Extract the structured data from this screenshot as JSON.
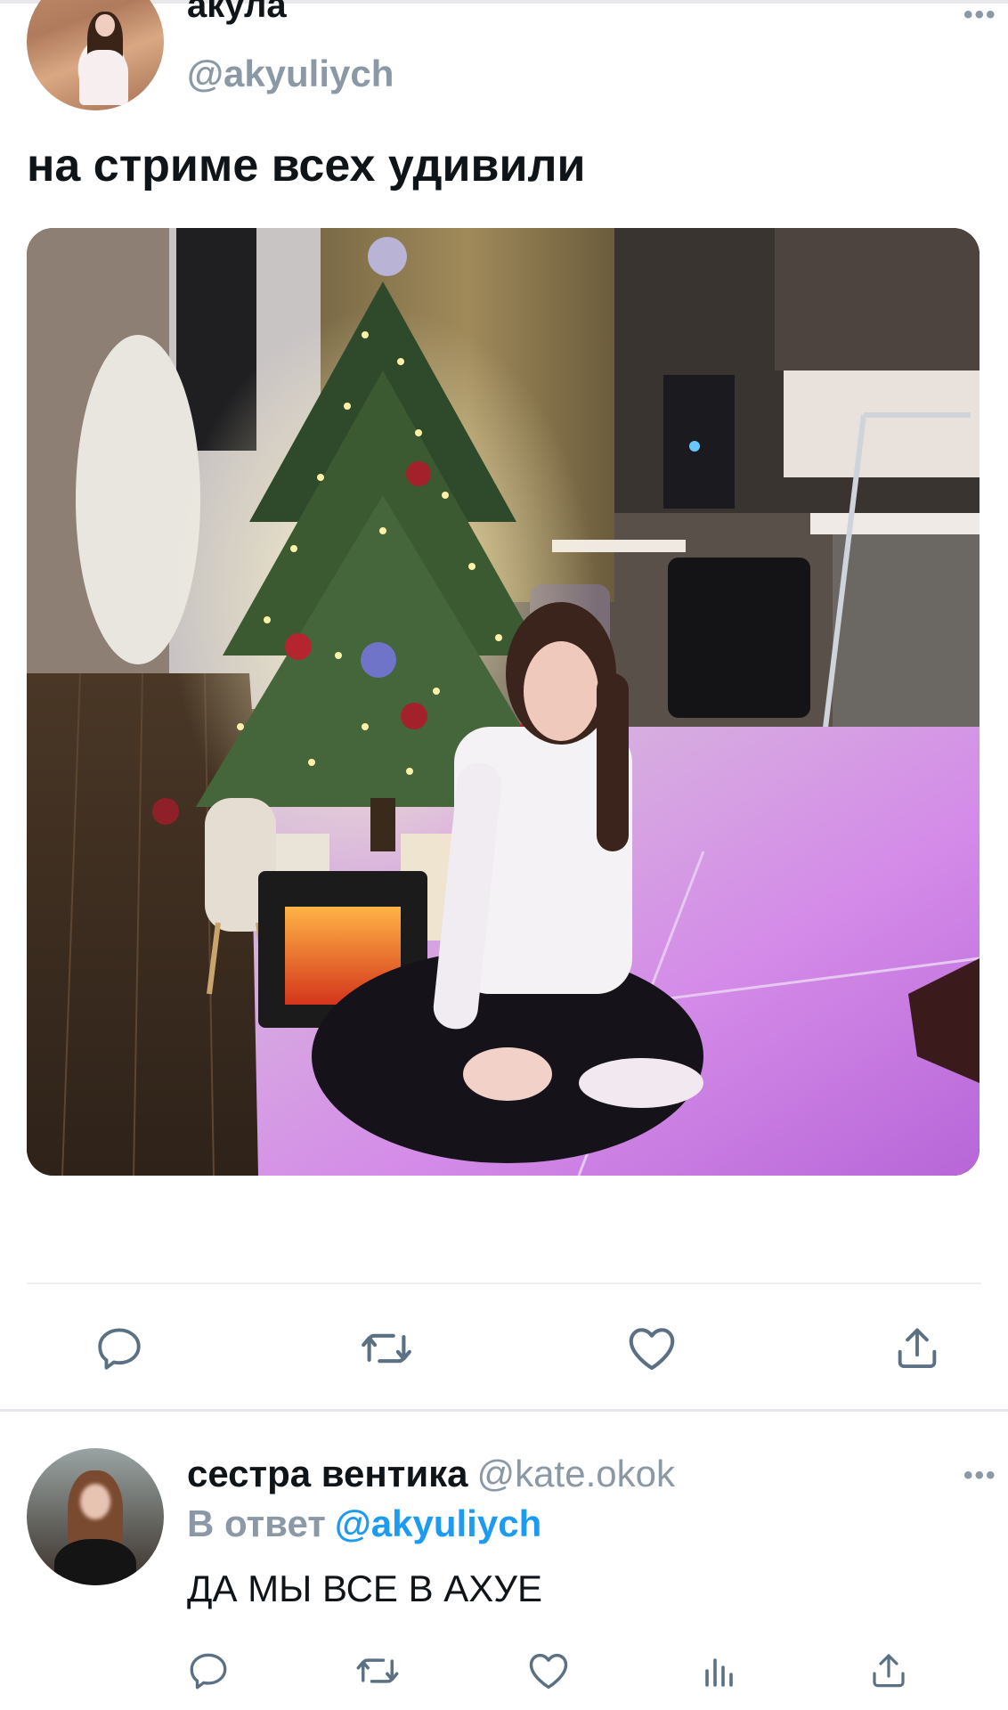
{
  "main_tweet": {
    "display_name": "акула",
    "handle": "@akyuliych",
    "text": "на стриме всех удивили",
    "more_icon": "more-horizontal-icon",
    "photo_alt": "christmas-tree-photo"
  },
  "main_actions": [
    {
      "name": "reply",
      "icon": "reply-icon"
    },
    {
      "name": "retweet",
      "icon": "retweet-icon"
    },
    {
      "name": "like",
      "icon": "heart-icon"
    },
    {
      "name": "share",
      "icon": "share-icon"
    }
  ],
  "reply_tweet": {
    "display_name": "сестра вентика",
    "handle": "@kate.okok",
    "reply_to_label": "В ответ",
    "reply_to_handle": "@akyuliych",
    "text": "ДА МЫ ВСЕ В АХУЕ",
    "more_icon": "more-horizontal-icon"
  },
  "reply_actions": [
    {
      "name": "reply",
      "icon": "reply-icon"
    },
    {
      "name": "retweet",
      "icon": "retweet-icon"
    },
    {
      "name": "like",
      "icon": "heart-icon"
    },
    {
      "name": "views",
      "icon": "analytics-icon"
    },
    {
      "name": "share",
      "icon": "share-icon"
    }
  ],
  "colors": {
    "text_primary": "#0f1419",
    "text_secondary": "#8b98a5",
    "accent": "#1d9bf0",
    "icon": "#5b7083"
  }
}
